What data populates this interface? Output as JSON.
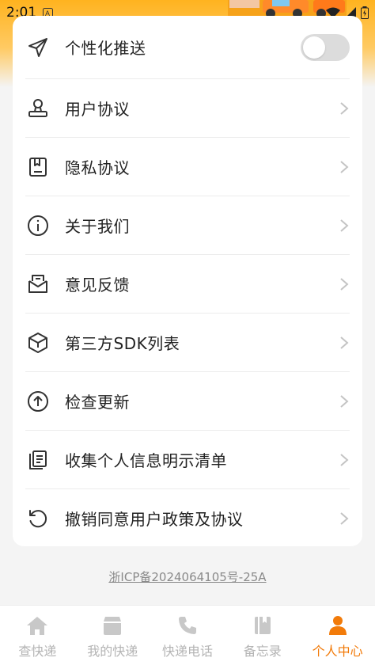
{
  "status_bar": {
    "time": "2:01"
  },
  "settings": {
    "items": [
      {
        "label": "个性化推送",
        "icon": "send-icon",
        "type": "toggle",
        "toggle_on": false
      },
      {
        "label": "用户协议",
        "icon": "stamp-icon",
        "type": "link"
      },
      {
        "label": "隐私协议",
        "icon": "document-bookmark-icon",
        "type": "link"
      },
      {
        "label": "关于我们",
        "icon": "info-icon",
        "type": "link"
      },
      {
        "label": "意见反馈",
        "icon": "feedback-mail-icon",
        "type": "link"
      },
      {
        "label": "第三方SDK列表",
        "icon": "cube-icon",
        "type": "link"
      },
      {
        "label": "检查更新",
        "icon": "arrow-up-circle-icon",
        "type": "link"
      },
      {
        "label": "收集个人信息明示清单",
        "icon": "copy-list-icon",
        "type": "link"
      },
      {
        "label": "撤销同意用户政策及协议",
        "icon": "revoke-icon",
        "type": "link"
      }
    ]
  },
  "footer": {
    "icp": "浙ICP备2024064105号-25A"
  },
  "tabbar": {
    "tabs": [
      {
        "label": "查快递",
        "icon": "home-icon",
        "active": false
      },
      {
        "label": "我的快递",
        "icon": "package-icon",
        "active": false
      },
      {
        "label": "快递电话",
        "icon": "phone-icon",
        "active": false
      },
      {
        "label": "备忘录",
        "icon": "book-icon",
        "active": false
      },
      {
        "label": "个人中心",
        "icon": "person-icon",
        "active": true
      }
    ]
  },
  "colors": {
    "accent": "#f27b0a",
    "header": "#ffb31f",
    "inactive": "#b4b4b4"
  }
}
